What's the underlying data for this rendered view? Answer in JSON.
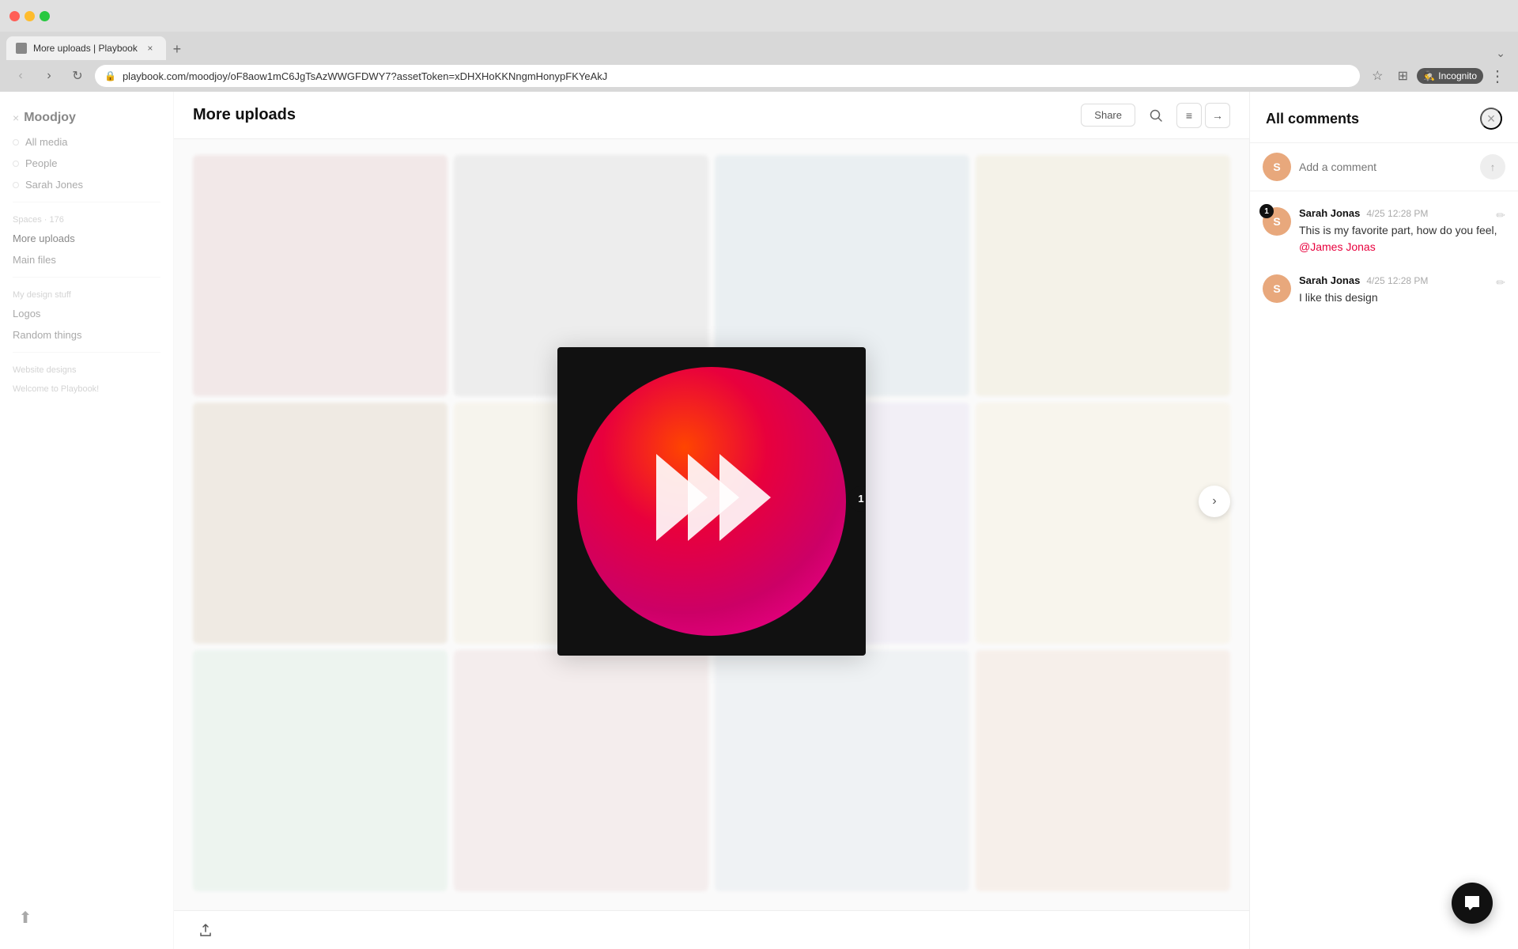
{
  "browser": {
    "tab_title": "More uploads | Playbook",
    "url": "playbook.com/moodjoy/oF8aow1mC6JgTsAzWWGFDWY7?assetToken=xDHXHoKKNngmHonypFKYeAkJ",
    "incognito_label": "Incognito"
  },
  "app": {
    "logo": "Moodjoy",
    "close_icon": "×"
  },
  "sidebar": {
    "items": [
      {
        "label": "All media"
      },
      {
        "label": "People"
      },
      {
        "label": "Sarah Jones"
      }
    ],
    "section_spaces": "Spaces · 176",
    "subsections": [
      {
        "label": "More uploads",
        "active": true
      },
      {
        "label": "Main files"
      }
    ],
    "section_design": "My design stuff",
    "design_items": [
      {
        "label": "Logos"
      },
      {
        "label": "Random things"
      }
    ],
    "section_website": "Website designs",
    "section_welcome": "Welcome to Playbook!"
  },
  "page": {
    "title": "More uploads",
    "share_label": "Share",
    "nav_arrows": {
      "list_icon": "≡",
      "right_icon": "→"
    }
  },
  "asset": {
    "comment_number": "1",
    "nav_right": "›"
  },
  "comments": {
    "panel_title": "All comments",
    "input_placeholder": "Add a comment",
    "submit_icon": "↑",
    "close_icon": "×",
    "items": [
      {
        "author": "Sarah Jonas",
        "time": "4/25 12:28 PM",
        "text": "This is my favorite part, how do you feel,",
        "mention": "@James Jonas",
        "number": "1",
        "avatar_letter": "S"
      },
      {
        "author": "Sarah Jonas",
        "time": "4/25 12:28 PM",
        "text": "I like this design",
        "mention": "",
        "number": "",
        "avatar_letter": "S"
      }
    ]
  },
  "toolbar": {
    "upload_icon": "⬆"
  },
  "chat": {
    "icon": "💬"
  }
}
